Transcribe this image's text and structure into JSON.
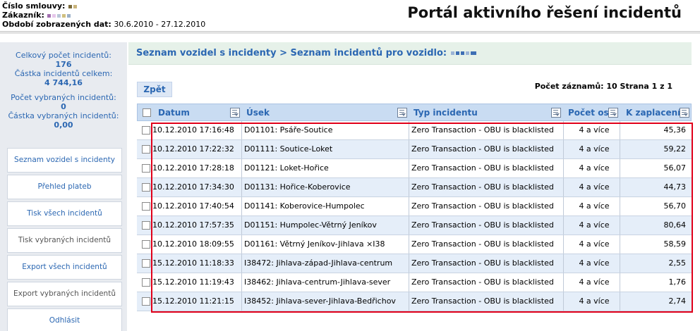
{
  "header": {
    "contract_label": "Číslo smlouvy:",
    "customer_label": "Zákazník:",
    "period_label": "Období zobrazených dat:",
    "period_value": "30.6.2010 - 27.12.2010",
    "portal_title": "Portál aktivního řešení incidentů"
  },
  "sidebar": {
    "total_count_label": "Celkový počet incidentů:",
    "total_count_value": "176",
    "total_amount_label": "Částka incidentů celkem:",
    "total_amount_value": "4 744,16",
    "selected_count_label": "Počet vybraných incidentů:",
    "selected_count_value": "0",
    "selected_amount_label": "Částka vybraných incidentů:",
    "selected_amount_value": "0,00",
    "menu": [
      {
        "label": "Seznam vozidel s incidenty"
      },
      {
        "label": "Přehled plateb"
      },
      {
        "label": "Tisk všech incidentů"
      },
      {
        "label": "Tisk vybraných incidentů"
      },
      {
        "label": "Export všech incidentů"
      },
      {
        "label": "Export vybraných incidentů"
      },
      {
        "label": "Odhlásit"
      }
    ]
  },
  "main": {
    "breadcrumb": "Seznam vozidel s incidenty > Seznam incidentů pro vozidlo:",
    "back_label": "Zpět",
    "record_info": "Počet záznamů: 10 Strana 1 z 1",
    "columns": {
      "date": "Datum",
      "usek": "Úsek",
      "typ": "Typ incidentu",
      "pocet": "Počet os",
      "kzap": "K zaplacení"
    },
    "rows": [
      {
        "date": "10.12.2010 17:16:48",
        "usek": "D01101: Psáře-Soutice",
        "typ": "Zero Transaction - OBU is blacklisted",
        "pocet": "4 a více",
        "kzap": "45,36"
      },
      {
        "date": "10.12.2010 17:22:32",
        "usek": "D01111: Soutice-Loket",
        "typ": "Zero Transaction - OBU is blacklisted",
        "pocet": "4 a více",
        "kzap": "59,22"
      },
      {
        "date": "10.12.2010 17:28:18",
        "usek": "D01121: Loket-Hořice",
        "typ": "Zero Transaction - OBU is blacklisted",
        "pocet": "4 a více",
        "kzap": "56,07"
      },
      {
        "date": "10.12.2010 17:34:30",
        "usek": "D01131: Hořice-Koberovice",
        "typ": "Zero Transaction - OBU is blacklisted",
        "pocet": "4 a více",
        "kzap": "44,73"
      },
      {
        "date": "10.12.2010 17:40:54",
        "usek": "D01141: Koberovice-Humpolec",
        "typ": "Zero Transaction - OBU is blacklisted",
        "pocet": "4 a více",
        "kzap": "56,70"
      },
      {
        "date": "10.12.2010 17:57:35",
        "usek": "D01151: Humpolec-Větrný Jeníkov",
        "typ": "Zero Transaction - OBU is blacklisted",
        "pocet": "4 a více",
        "kzap": "80,64"
      },
      {
        "date": "10.12.2010 18:09:55",
        "usek": "D01161: Větrný Jeníkov-Jihlava ×I38",
        "typ": "Zero Transaction - OBU is blacklisted",
        "pocet": "4 a více",
        "kzap": "58,59"
      },
      {
        "date": "15.12.2010 11:18:33",
        "usek": "I38472: Jihlava-západ-Jihlava-centrum",
        "typ": "Zero Transaction - OBU is blacklisted",
        "pocet": "4 a více",
        "kzap": "2,55"
      },
      {
        "date": "15.12.2010 11:19:43",
        "usek": "I38462: Jihlava-centrum-Jihlava-sever",
        "typ": "Zero Transaction - OBU is blacklisted",
        "pocet": "4 a více",
        "kzap": "1,76"
      },
      {
        "date": "15.12.2010 11:21:15",
        "usek": "I38452: Jihlava-sever-Jihlava-Bedřichov",
        "typ": "Zero Transaction - OBU is blacklisted",
        "pocet": "4 a více",
        "kzap": "2,74"
      }
    ]
  },
  "colors": {
    "link_blue": "#2b67b2",
    "header_blue": "#c9dcf2",
    "row_alt": "#e5eef9",
    "sidebar_bg": "#e8ebf0",
    "crumb_bg": "#e6f1e9",
    "highlight_red": "#e0001a"
  }
}
